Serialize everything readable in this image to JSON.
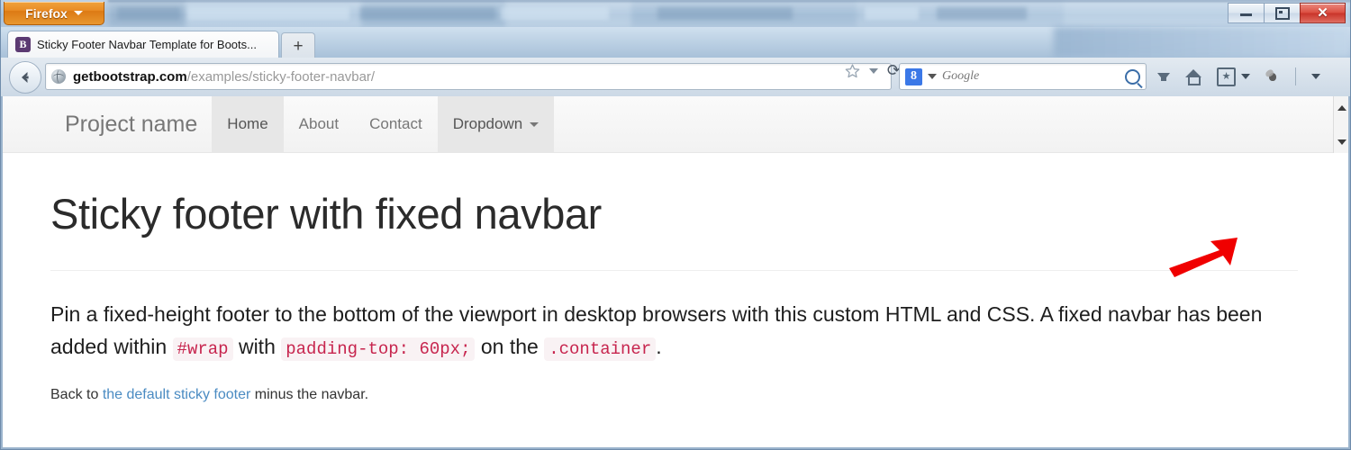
{
  "titlebar": {
    "firefox_button": "Firefox",
    "minimize_label": "–",
    "restore_label": "□",
    "close_label": "✕"
  },
  "tabs": {
    "active_tab_title": "Sticky Footer Navbar Template for Boots...",
    "favicon_letter": "B",
    "new_tab_label": "+"
  },
  "toolbar": {
    "back_label": "←",
    "url_domain": "getbootstrap.com",
    "url_path": "/examples/sticky-footer-navbar/",
    "url_full": "getbootstrap.com/examples/sticky-footer-navbar/",
    "bookmark_star": "☆",
    "reload_label": "⟳",
    "search_engine_letter": "8",
    "search_placeholder": "Google",
    "search_value": "",
    "download_icon": "download-icon",
    "home_icon": "home-icon",
    "bookmarks_icon": "bookmarks-star-icon",
    "addon_icon": "addon-icon",
    "overflow_label": "▾"
  },
  "navbar": {
    "brand": "Project name",
    "items": [
      {
        "label": "Home",
        "state": "active"
      },
      {
        "label": "About",
        "state": "default"
      },
      {
        "label": "Contact",
        "state": "default"
      },
      {
        "label": "Dropdown",
        "state": "hover",
        "caret": true
      }
    ]
  },
  "scrollbar": {
    "up_arrow": "▲",
    "down_arrow": "▼"
  },
  "main": {
    "heading": "Sticky footer with fixed navbar",
    "lead_part1": "Pin a fixed-height footer to the bottom of the viewport in desktop browsers with this custom HTML and CSS. A fixed navbar has been added within ",
    "code1": "#wrap",
    "lead_part2": " with ",
    "code2": "padding-top: 60px;",
    "lead_part3": " on the ",
    "code3": ".container",
    "lead_part4": ".",
    "back_prefix": "Back to ",
    "back_link": "the default sticky footer",
    "back_suffix": " minus the navbar."
  },
  "annotation": {
    "arrow_color": "#f00000",
    "description": "red-arrow-pointing-to-scrollbar"
  },
  "colors": {
    "code_text": "#c7254e",
    "code_bg": "#f9f2f4",
    "link": "#4a8bc2",
    "navbar_bg": "#f8f8f8",
    "navbar_active_bg": "#e7e7e7",
    "nav_text": "#777777",
    "firefox_orange": "#e98c25"
  }
}
